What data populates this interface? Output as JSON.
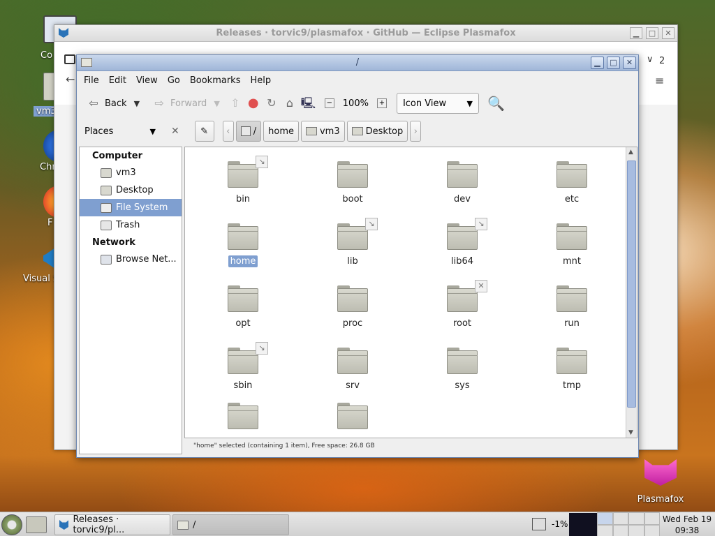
{
  "desktop": {
    "icons": [
      {
        "label": "Co"
      },
      {
        "label": "vm3"
      },
      {
        "label": "Chr"
      },
      {
        "label": "F"
      },
      {
        "label": "Visual S"
      }
    ],
    "plasmafox_label": "Plasmafox"
  },
  "browser": {
    "title": "Releases · torvic9/plasmafox · GitHub — Eclipse Plasmafox",
    "tab_count": "2"
  },
  "filemanager": {
    "title": "/",
    "menu": [
      "File",
      "Edit",
      "View",
      "Go",
      "Bookmarks",
      "Help"
    ],
    "toolbar": {
      "back": "Back",
      "forward": "Forward",
      "zoom": "100%",
      "view_mode": "Icon View"
    },
    "pathbar": {
      "root": "/",
      "crumbs": [
        "home",
        "vm3",
        "Desktop"
      ]
    },
    "sidebar": {
      "selector": "Places",
      "sections": [
        {
          "heading": "Computer",
          "items": [
            "vm3",
            "Desktop",
            "File System",
            "Trash"
          ]
        },
        {
          "heading": "Network",
          "items": [
            "Browse Net..."
          ]
        }
      ],
      "selected": "File System"
    },
    "folders": [
      {
        "name": "bin",
        "emblem": "link"
      },
      {
        "name": "boot",
        "emblem": ""
      },
      {
        "name": "dev",
        "emblem": ""
      },
      {
        "name": "etc",
        "emblem": ""
      },
      {
        "name": "home",
        "emblem": "",
        "selected": true
      },
      {
        "name": "lib",
        "emblem": "link"
      },
      {
        "name": "lib64",
        "emblem": "link"
      },
      {
        "name": "mnt",
        "emblem": ""
      },
      {
        "name": "opt",
        "emblem": ""
      },
      {
        "name": "proc",
        "emblem": ""
      },
      {
        "name": "root",
        "emblem": "locked"
      },
      {
        "name": "run",
        "emblem": ""
      },
      {
        "name": "sbin",
        "emblem": "link"
      },
      {
        "name": "srv",
        "emblem": ""
      },
      {
        "name": "sys",
        "emblem": ""
      },
      {
        "name": "tmp",
        "emblem": ""
      },
      {
        "name": "",
        "emblem": ""
      },
      {
        "name": "",
        "emblem": ""
      }
    ],
    "status": "\"home\" selected (containing 1 item), Free space: 26.8 GB"
  },
  "taskbar": {
    "tasks": [
      "Releases · torvic9/pl...",
      "/"
    ],
    "cpu": "-1%",
    "date": "Wed Feb 19",
    "time": "09:38"
  }
}
